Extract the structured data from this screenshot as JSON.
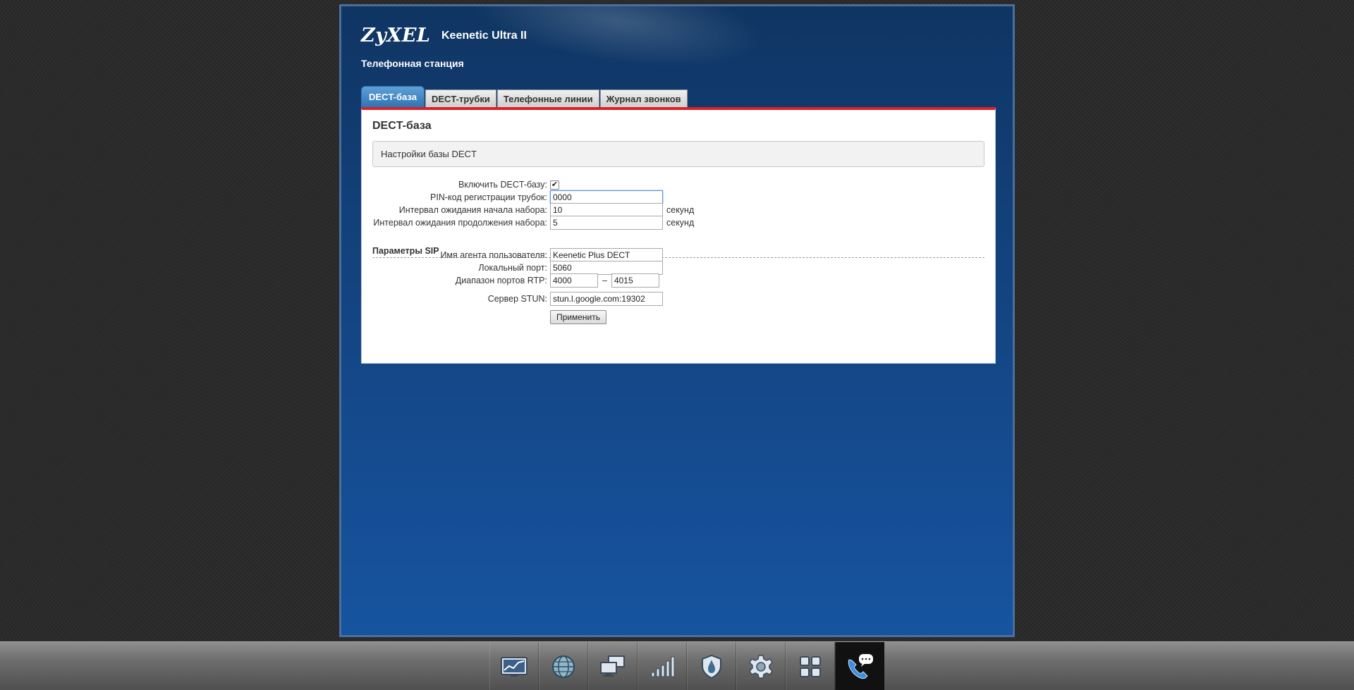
{
  "brand": {
    "logo": "ZyXEL",
    "model": "Keenetic Ultra II"
  },
  "page_heading": "Телефонная станция",
  "tabs": [
    {
      "label": "DECT-база",
      "active": true
    },
    {
      "label": "DECT-трубки",
      "active": false
    },
    {
      "label": "Телефонные линии",
      "active": false
    },
    {
      "label": "Журнал звонков",
      "active": false
    }
  ],
  "panel": {
    "title": "DECT-база",
    "info": "Настройки базы DECT",
    "fields": {
      "enable_dect": {
        "label": "Включить DECT-базу:",
        "checked": true
      },
      "pin": {
        "label": "PIN-код регистрации трубок:",
        "value": "0000"
      },
      "dial_start_timeout": {
        "label": "Интервал ожидания начала набора:",
        "value": "10",
        "unit": "секунд"
      },
      "dial_continue_timeout": {
        "label": "Интервал ожидания продолжения набора:",
        "value": "5",
        "unit": "секунд"
      }
    },
    "sip_section": "Параметры SIP",
    "sip": {
      "user_agent": {
        "label": "Имя агента пользователя:",
        "value": "Keenetic Plus DECT"
      },
      "local_port": {
        "label": "Локальный порт:",
        "value": "5060"
      },
      "rtp_range": {
        "label": "Диапазон портов RTP:",
        "from": "4000",
        "separator": "–",
        "to": "4015"
      },
      "stun": {
        "label": "Сервер STUN:",
        "value": "stun.l.google.com:19302"
      }
    },
    "apply_label": "Применить"
  },
  "dock": [
    {
      "icon": "monitor-graph-icon"
    },
    {
      "icon": "globe-icon"
    },
    {
      "icon": "network-computers-icon"
    },
    {
      "icon": "signal-bars-icon"
    },
    {
      "icon": "shield-icon"
    },
    {
      "icon": "gear-icon"
    },
    {
      "icon": "apps-grid-icon"
    },
    {
      "icon": "phone-chat-icon",
      "active": true
    }
  ],
  "colors": {
    "accent_red": "#d92128",
    "tab_active": "#2f74b4",
    "frame_blue": "#154b8f"
  }
}
